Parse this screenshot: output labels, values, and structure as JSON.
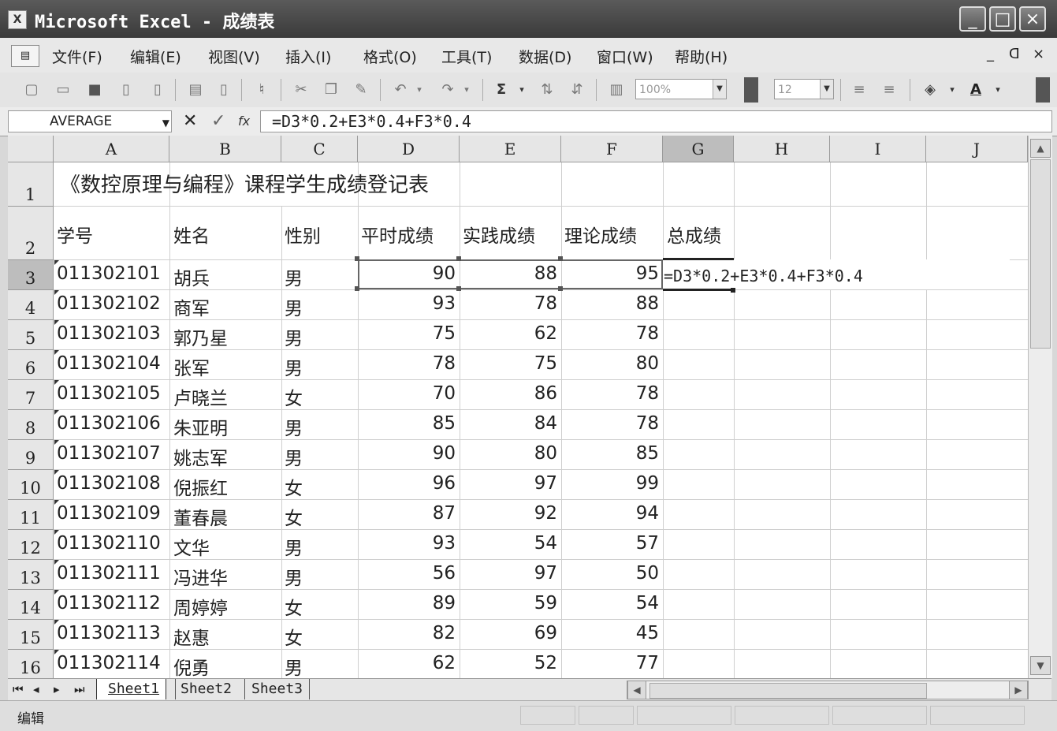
{
  "window": {
    "title": "Microsoft Excel - 成绩表",
    "app_icon": "X",
    "controls": [
      "_",
      "□",
      "×"
    ]
  },
  "menu": {
    "items": [
      "文件(F)",
      "编辑(E)",
      "视图(V)",
      "插入(I)",
      "格式(O)",
      "工具(T)",
      "数据(D)",
      "窗口(W)",
      "帮助(H)"
    ],
    "doc_controls": [
      "_",
      "ᗡ",
      "×"
    ]
  },
  "toolbar": {
    "zoom": "100%",
    "font_size": "12"
  },
  "formula_bar": {
    "name_box": "AVERAGE",
    "formula": "=D3*0.2+E3*0.4+F3*0.4"
  },
  "sheet": {
    "columns": [
      "A",
      "B",
      "C",
      "D",
      "E",
      "F",
      "G",
      "H",
      "I",
      "J"
    ],
    "title": "《数控原理与编程》课程学生成绩登记表",
    "headers": [
      "学号",
      "姓名",
      "性别",
      "平时成绩",
      "实践成绩",
      "理论成绩",
      "总成绩"
    ],
    "rows": [
      [
        "011302101",
        "胡兵",
        "男",
        "90",
        "88",
        "95"
      ],
      [
        "011302102",
        "商军",
        "男",
        "93",
        "78",
        "88"
      ],
      [
        "011302103",
        "郭乃星",
        "男",
        "75",
        "62",
        "78"
      ],
      [
        "011302104",
        "张军",
        "男",
        "78",
        "75",
        "80"
      ],
      [
        "011302105",
        "卢晓兰",
        "女",
        "70",
        "86",
        "78"
      ],
      [
        "011302106",
        "朱亚明",
        "男",
        "85",
        "84",
        "78"
      ],
      [
        "011302107",
        "姚志军",
        "男",
        "90",
        "80",
        "85"
      ],
      [
        "011302108",
        "倪振红",
        "女",
        "96",
        "97",
        "99"
      ],
      [
        "011302109",
        "董春晨",
        "女",
        "87",
        "92",
        "94"
      ],
      [
        "011302110",
        "文华",
        "男",
        "93",
        "54",
        "57"
      ],
      [
        "011302111",
        "冯进华",
        "男",
        "56",
        "97",
        "50"
      ],
      [
        "011302112",
        "周婷婷",
        "女",
        "89",
        "59",
        "54"
      ],
      [
        "011302113",
        "赵惠",
        "女",
        "82",
        "69",
        "45"
      ],
      [
        "011302114",
        "倪勇",
        "男",
        "62",
        "52",
        "77"
      ]
    ],
    "g3_formula": "=D3*0.2+E3*0.4+F3*0.4"
  },
  "tabs": [
    "Sheet1",
    "Sheet2",
    "Sheet3"
  ],
  "status": "编辑"
}
